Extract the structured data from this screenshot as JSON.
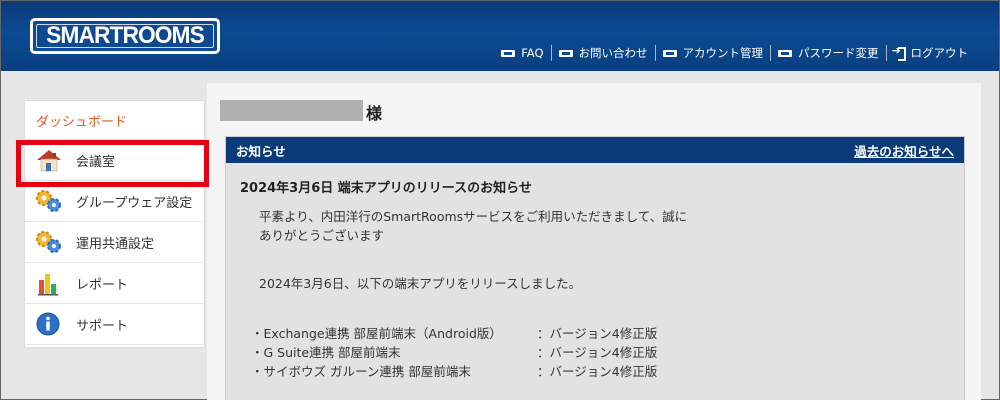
{
  "header": {
    "logo_text": "SMARTROOMS",
    "nav": [
      {
        "label": "FAQ",
        "icon": "list-icon"
      },
      {
        "label": "お問い合わせ",
        "icon": "list-icon"
      },
      {
        "label": "アカウント管理",
        "icon": "list-icon"
      },
      {
        "label": "パスワード変更",
        "icon": "list-icon"
      },
      {
        "label": "ログアウト",
        "icon": "logout-icon"
      }
    ]
  },
  "sidebar": {
    "heading": "ダッシュボード",
    "items": [
      {
        "label": "会議室",
        "icon": "house-icon"
      },
      {
        "label": "グループウェア設定",
        "icon": "gears-icon"
      },
      {
        "label": "運用共通設定",
        "icon": "gears-icon"
      },
      {
        "label": "レポート",
        "icon": "bar-chart-icon"
      },
      {
        "label": "サポート",
        "icon": "info-icon"
      }
    ]
  },
  "main": {
    "user_suffix": "様",
    "notice": {
      "header_label": "お知らせ",
      "past_link": "過去のお知らせへ",
      "title": "2024年3月6日 端末アプリのリリースのお知らせ",
      "para1_line1": "平素より、内田洋行のSmartRoomsサービスをご利用いただきまして、誠に",
      "para1_line2": "ありがとうございます",
      "para2": "2024年3月6日、以下の端末アプリをリリースしました。",
      "releases": [
        {
          "name": "・Exchange連携 部屋前端末（Android版）",
          "version": "：バージョン4修正版"
        },
        {
          "name": "・G Suite連携 部屋前端末",
          "version": "：バージョン4修正版"
        },
        {
          "name": "・サイボウズ ガルーン連携 部屋前端末",
          "version": "：バージョン4修正版"
        }
      ]
    }
  },
  "colors": {
    "header_blue": "#0d4a93",
    "notice_blue": "#0a3a78",
    "accent_orange": "#e8571c",
    "highlight_red": "#e60012"
  }
}
